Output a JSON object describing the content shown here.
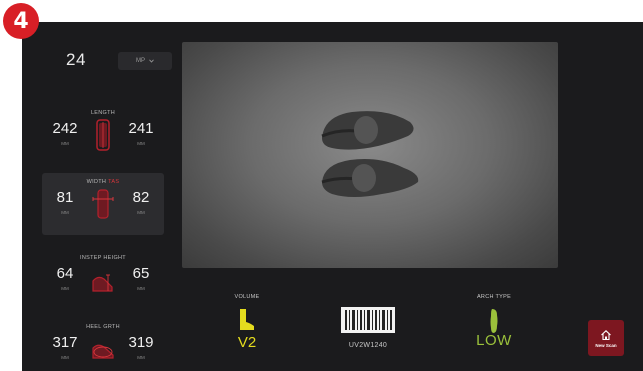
{
  "step_badge": "4",
  "size": {
    "value": "24",
    "unit_select": "MP"
  },
  "metrics": [
    {
      "title": "LENGTH",
      "subtitle": "",
      "left": "242",
      "right": "241",
      "unit": "MM"
    },
    {
      "title": "WIDTH",
      "subtitle": "TAS",
      "left": "81",
      "right": "82",
      "unit": "MM"
    },
    {
      "title": "INSTEP HEIGHT",
      "subtitle": "",
      "left": "64",
      "right": "65",
      "unit": "MM"
    },
    {
      "title": "HEEL GRTH",
      "subtitle": "",
      "left": "317",
      "right": "319",
      "unit": "MM"
    }
  ],
  "volume": {
    "label": "VOLUME",
    "value": "V2",
    "icon": "boot-icon"
  },
  "barcode": {
    "code": "UV2W1240",
    "icon": "barcode-icon"
  },
  "arch_type": {
    "label": "ARCH TYPE",
    "value": "LOW",
    "icon": "foot-arch-icon"
  },
  "new_scan": {
    "label": "New Scan",
    "icon": "home-icon"
  },
  "colors": {
    "accent_red": "#d81f26",
    "volume_yellow": "#e4dc1e",
    "arch_green": "#9bc13b",
    "button_maroon": "#7d1720"
  }
}
